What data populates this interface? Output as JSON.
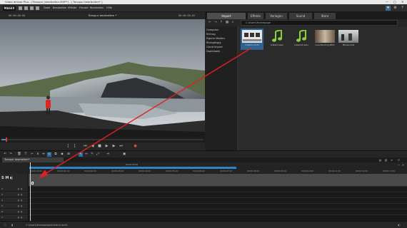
{
  "window": {
    "title": "Video deluxe Plus - [Tonspur_bearbeiten.MXP*] - [ Tonspur bearbeiten* ]",
    "controls": [
      "—",
      "▢",
      "✕"
    ]
  },
  "menubar": {
    "logo": "MAGIX",
    "menus": [
      "Datei",
      "Bearbeiten",
      "Effekte",
      "Fenster",
      "Bearbeiten",
      "Hilfe"
    ]
  },
  "preview": {
    "timecode_left": "00:00:00:00",
    "title": "Tonspur bearbeiten *",
    "timecode_right": "00:00:05:02",
    "progress": 0.02
  },
  "media_pool": {
    "tabs": [
      "Import",
      "Effekte",
      "Vorlagen",
      "Sound",
      "Store"
    ],
    "active_tab": "Import",
    "path": "C:\\Users\\Homepage",
    "sidebar": [
      "Computer",
      "Eintrag",
      "Eigene Medien",
      "Rückgängig",
      "Cloud Import",
      "Downloads"
    ],
    "files": [
      {
        "name": "Iceland.mxfx",
        "type": "project",
        "selected": true
      },
      {
        "name": "Iceland.wav",
        "type": "audio",
        "selected": false
      },
      {
        "name": "Iceland2.wav",
        "type": "audio",
        "selected": false
      },
      {
        "name": "Live Painting.MOV",
        "type": "video",
        "selected": false
      },
      {
        "name": "Movie.mp4",
        "type": "video",
        "selected": false
      }
    ]
  },
  "timeline": {
    "project_tab": "Tonspur bearbeiten*",
    "ruler_marker": "00:00:02:00",
    "ruler_ticks": [
      "00:00:00:00",
      "00:00:01:00",
      "00:00:02:00",
      "00:00:03:00",
      "00:00:04:00",
      "00:00:05:00",
      "00:00:06:00",
      "00:00:07:00",
      "00:00:08:00",
      "00:00:09:00",
      "00:00:10:00",
      "00:00:11:00",
      "00:00:12:00",
      "00:00:13:00"
    ],
    "track_controls": "S M ◐",
    "tracks": [
      "1",
      "2",
      "3",
      "4",
      "5",
      "6",
      "7",
      "8"
    ]
  },
  "status": {
    "path": "C:\\Users\\Homepage\\Iceland.mxfx"
  },
  "colors": {
    "accent": "#2f83c9",
    "arrow": "#e02020",
    "record": "#e24a3a"
  }
}
